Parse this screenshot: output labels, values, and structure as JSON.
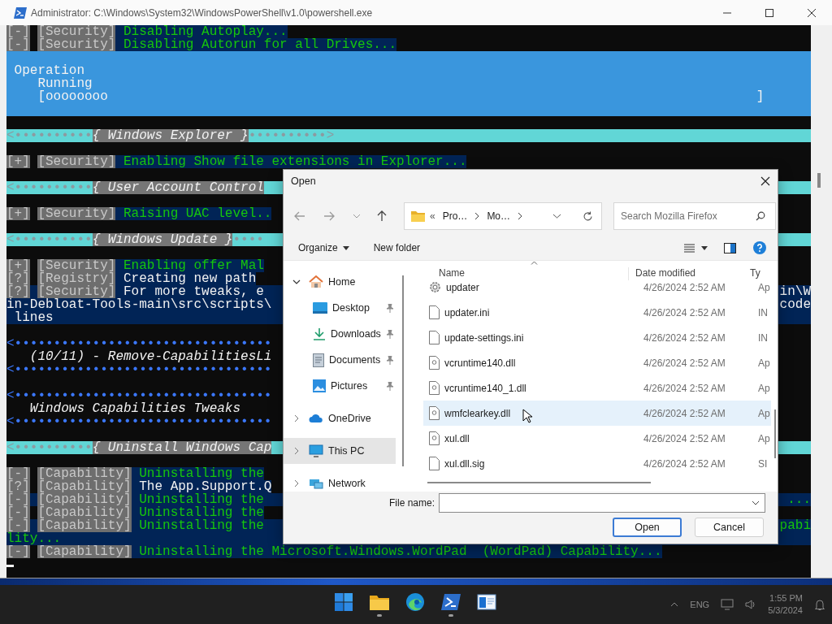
{
  "window": {
    "title": "Administrator: C:\\Windows\\System32\\WindowsPowerShell\\v1.0\\powershell.exe"
  },
  "terminal": {
    "lines": [
      {
        "kind": "success",
        "status": "[-]",
        "tag": "[Security]",
        "message": "Disabling Autoplay..."
      },
      {
        "kind": "success",
        "status": "[-]",
        "tag": "[Security]",
        "message": "Disabling Autorun for all Drives..."
      },
      {
        "kind": "progress",
        "title": "Operation",
        "status": "Running",
        "bar": "[oooooooo",
        "end": "]"
      },
      {
        "kind": "blank"
      },
      {
        "kind": "banner",
        "lead": "<••••••••••",
        "title": "{ Windows Explorer }",
        "tail": "••••••••••>"
      },
      {
        "kind": "blank"
      },
      {
        "kind": "success",
        "status": "[+]",
        "tag": "[Security]",
        "message": "Enabling Show file extensions in Explorer..."
      },
      {
        "kind": "blank"
      },
      {
        "kind": "banner",
        "lead": "<••••••••••",
        "title": "{ User Account Control"
      },
      {
        "kind": "blank"
      },
      {
        "kind": "success",
        "status": "[+]",
        "tag": "[Security]",
        "message": "Raising UAC level.."
      },
      {
        "kind": "blank"
      },
      {
        "kind": "banner",
        "lead": "<••••••••••",
        "title": "{ Windows Update }",
        "tail": "••••"
      },
      {
        "kind": "blank"
      },
      {
        "kind": "success",
        "status": "[+]",
        "tag": "[Security]",
        "message": "Enabling offer Mal"
      },
      {
        "kind": "notice",
        "status": "[?]",
        "tag": "[Registry]",
        "message": "Creating new path"
      },
      {
        "kind": "notice",
        "status": "[?]",
        "tag": "[Security]",
        "message": "For more tweaks, e",
        "right": "in\\W"
      },
      {
        "kind": "noticetail",
        "text": "in-Debloat-Tools-main\\src\\scripts\\",
        "right": "code"
      },
      {
        "kind": "noticetail",
        "text": "lines",
        "indented": true
      },
      {
        "kind": "blank"
      },
      {
        "kind": "rule",
        "text": "<•••••••••••••••••••••••••••••••••"
      },
      {
        "kind": "heading",
        "text": "(10/11) - Remove-CapabilitiesLi"
      },
      {
        "kind": "rule",
        "text": "<•••••••••••••••••••••••••••••••••"
      },
      {
        "kind": "blank"
      },
      {
        "kind": "rule",
        "text": "<•••••••••••••••••••••••••••••••••"
      },
      {
        "kind": "heading",
        "text": "Windows Capabilities Tweaks"
      },
      {
        "kind": "rule",
        "text": "<•••••••••••••••••••••••••••••••••"
      },
      {
        "kind": "blank"
      },
      {
        "kind": "banner",
        "lead": "<••••••••••",
        "title": "{ Uninstall Windows Cap"
      },
      {
        "kind": "blank"
      },
      {
        "kind": "success",
        "status": "[-]",
        "tag": "[Capability]",
        "message": "Uninstalling the"
      },
      {
        "kind": "notice",
        "status": "[?]",
        "tag": "[Capability]",
        "message": "The App.Support.Q"
      },
      {
        "kind": "success",
        "status": "[-]",
        "tag": "[Capability]",
        "message": "Uninstalling the",
        "right": "..."
      },
      {
        "kind": "success",
        "status": "[-]",
        "tag": "[Capability]",
        "message": "Uninstalling the"
      },
      {
        "kind": "success",
        "status": "[-]",
        "tag": "[Capability]",
        "message": "Uninstalling the",
        "right": "pabi"
      },
      {
        "kind": "successtail",
        "text": "lity..."
      },
      {
        "kind": "success",
        "status": "[-]",
        "tag": "[Capability]",
        "message": "Uninstalling the Microsoft.Windows.WordPad  (WordPad) Capability..."
      },
      {
        "kind": "cursor"
      }
    ]
  },
  "dialog": {
    "title": "Open",
    "path_prefix": "«",
    "path": [
      "Pro…",
      "Mo…"
    ],
    "search": {
      "placeholder": "Search Mozilla Firefox"
    },
    "toolbar": {
      "organize": "Organize",
      "new_folder": "New folder"
    },
    "nav": [
      {
        "label": "Home",
        "expanded": true,
        "selected": false,
        "children": [
          {
            "label": "Desktop",
            "pinned": true,
            "selected": false
          },
          {
            "label": "Downloads",
            "pinned": true,
            "selected": false
          },
          {
            "label": "Documents",
            "pinned": true,
            "selected": false
          },
          {
            "label": "Pictures",
            "pinned": true,
            "selected": false
          }
        ]
      },
      {
        "label": "OneDrive",
        "expanded": false,
        "selected": false
      },
      {
        "label": "This PC",
        "expanded": false,
        "selected": true
      },
      {
        "label": "Network",
        "expanded": false,
        "selected": false
      }
    ],
    "columns": [
      "Name",
      "Date modified",
      "Ty"
    ],
    "files": [
      {
        "name": "updater",
        "date": "4/26/2024 2:52 AM",
        "type": "Ap",
        "kind": "app",
        "hovered": false
      },
      {
        "name": "updater.ini",
        "date": "4/26/2024 2:52 AM",
        "type": "IN",
        "kind": "file",
        "hovered": false
      },
      {
        "name": "update-settings.ini",
        "date": "4/26/2024 2:52 AM",
        "type": "IN",
        "kind": "file",
        "hovered": false
      },
      {
        "name": "vcruntime140.dll",
        "date": "4/26/2024 2:52 AM",
        "type": "Ap",
        "kind": "dll",
        "hovered": false
      },
      {
        "name": "vcruntime140_1.dll",
        "date": "4/26/2024 2:52 AM",
        "type": "Ap",
        "kind": "dll",
        "hovered": false
      },
      {
        "name": "wmfclearkey.dll",
        "date": "4/26/2024 2:52 AM",
        "type": "Ap",
        "kind": "dll",
        "hovered": true
      },
      {
        "name": "xul.dll",
        "date": "4/26/2024 2:52 AM",
        "type": "Ap",
        "kind": "dll",
        "hovered": false
      },
      {
        "name": "xul.dll.sig",
        "date": "4/26/2024 2:52 AM",
        "type": "SI",
        "kind": "file",
        "hovered": false
      }
    ],
    "file_name_label": "File name:",
    "buttons": [
      {
        "label": "Open",
        "default": true
      },
      {
        "label": "Cancel",
        "default": false
      }
    ]
  },
  "taskbar": {
    "apps": [
      {
        "running": false
      },
      {
        "running": true
      },
      {
        "running": false
      },
      {
        "running": true
      },
      {
        "running": false
      }
    ],
    "language": "ENG",
    "time": "1:55 PM",
    "date": "5/3/2024"
  }
}
